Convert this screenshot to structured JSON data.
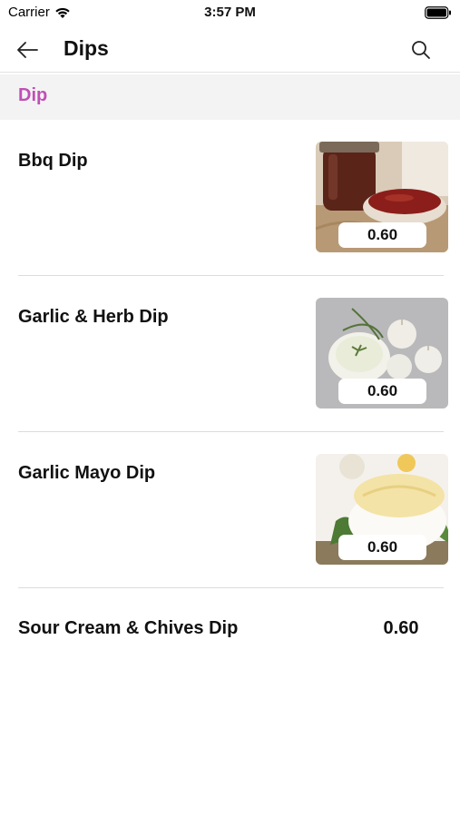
{
  "status_bar": {
    "carrier": "Carrier",
    "time": "3:57 PM"
  },
  "nav": {
    "title": "Dips",
    "icons": {
      "back": "arrow-left-icon",
      "search": "search-icon"
    }
  },
  "section": {
    "title": "Dip"
  },
  "items": [
    {
      "name": "Bbq Dip",
      "price": "0.60",
      "image": "bbq-dip-photo"
    },
    {
      "name": "Garlic & Herb Dip",
      "price": "0.60",
      "image": "garlic-herb-dip-photo"
    },
    {
      "name": "Garlic Mayo Dip",
      "price": "0.60",
      "image": "garlic-mayo-dip-photo"
    },
    {
      "name": "Sour Cream & Chives Dip",
      "price": "0.60"
    }
  ],
  "colors": {
    "accent": "#c04fb5",
    "section_background": "#f3f3f3",
    "divider": "#dcdcdc"
  }
}
